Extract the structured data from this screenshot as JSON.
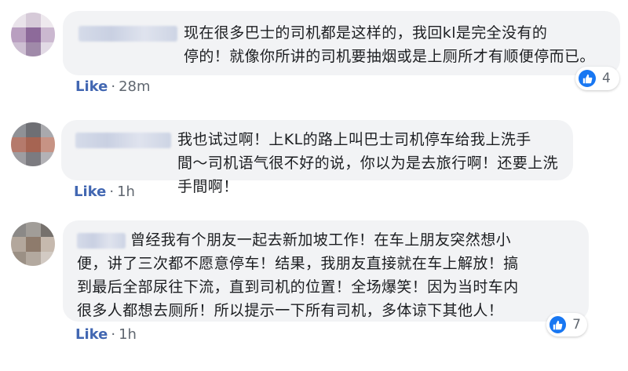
{
  "comments": [
    {
      "text": "现在很多巴士的司机都是这样的，我回kl是完全没有的\n停的！就像你所讲的司机要抽烟或是上厕所才有顺便停而已。",
      "like_label": "Like",
      "time": "28m",
      "reaction_count": "4"
    },
    {
      "text": "我也试过啊！上KL的路上叫巴士司机停车给我上洗手\n間～司机语气很不好的说，你以为是去旅行啊！还要上洗手間啊！",
      "like_label": "Like",
      "time": "1h"
    },
    {
      "text": "曾经我有个朋友一起去新加坡工作！在车上朋友突然想小\n便，讲了三次都不愿意停车！结果，我朋友直接就在车上解放！搞\n到最后全部尿往下流，直到司机的位置！全场爆笑！因为当时车内\n很多人都想去厕所！所以提示一下所有司机，多体谅下其他人！",
      "like_label": "Like",
      "time": "1h",
      "reaction_count": "7"
    }
  ],
  "colors": {
    "link_blue": "#4267b2",
    "bubble_gray": "#f2f3f5",
    "reaction_blue": "#1877f2"
  },
  "icons": [
    "thumbs-up-icon"
  ]
}
